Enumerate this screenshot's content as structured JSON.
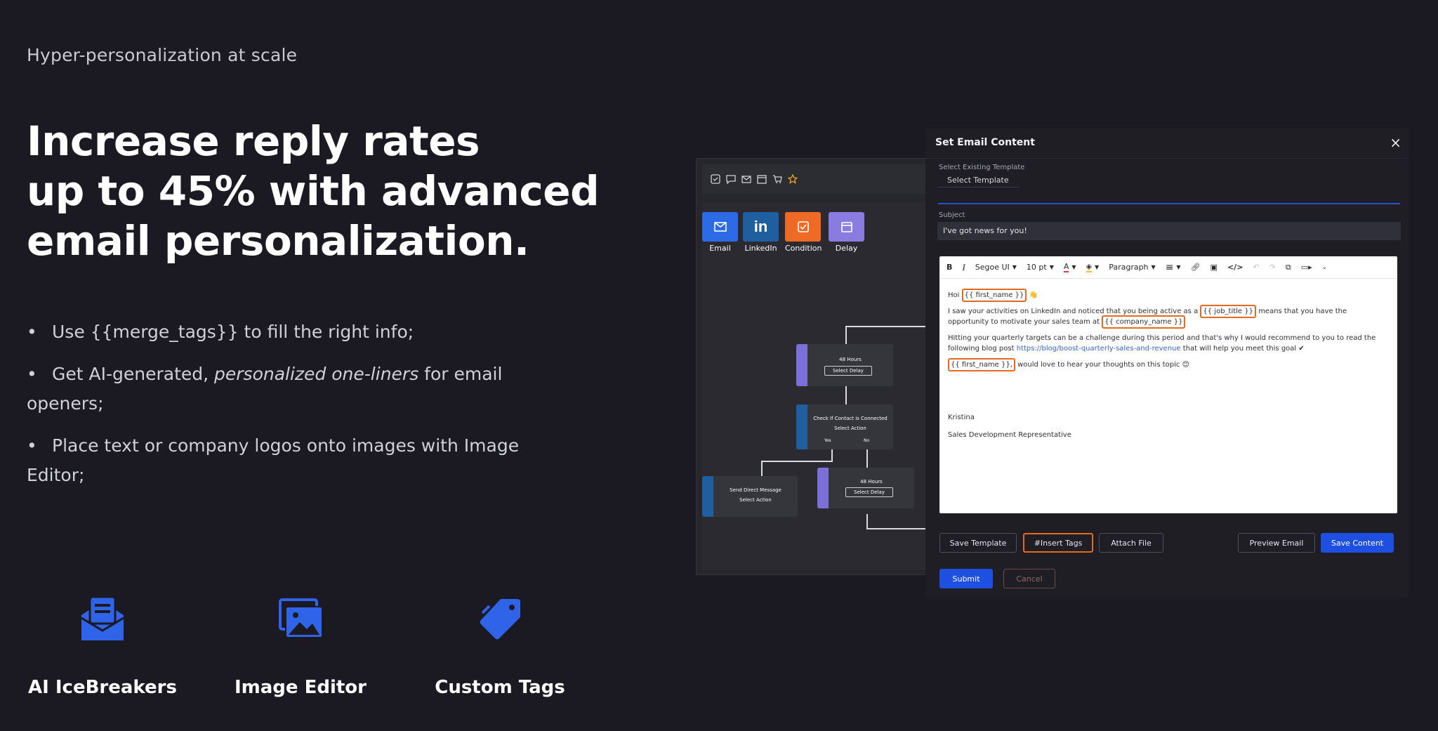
{
  "hero": {
    "eyebrow": "Hyper-personalization at scale",
    "headline_lines": [
      "Increase reply rates",
      "up to 45% with advanced",
      "email personalization."
    ]
  },
  "bullets": [
    {
      "text": "Use {{merge_tags}} to fill the right info;"
    },
    {
      "before": "Get AI-generated, ",
      "em": "personalized one-liners",
      "after": " for email openers;"
    },
    {
      "text": "Place text or company logos onto images with Image Editor;"
    }
  ],
  "features": [
    {
      "label": "AI IceBreakers",
      "icon": "envelope-open-icon"
    },
    {
      "label": "Image Editor",
      "icon": "images-icon"
    },
    {
      "label": "Custom Tags",
      "icon": "tags-icon"
    }
  ],
  "colors": {
    "background": "#1b1a22",
    "feature_icon": "#2f63e8",
    "primary_button": "#1d4fe0",
    "tag_border": "#e46a22",
    "email_node": "#2d6be6",
    "linkedin_node": "#1f5fa0",
    "condition_node": "#ee6a25",
    "delay_node": "#8a7be0"
  },
  "workflow": {
    "toolbar_icons": [
      "task-icon",
      "chat-icon",
      "mail-icon",
      "calendar-icon",
      "cart-icon",
      "star-icon"
    ],
    "node_buttons": [
      {
        "label": "Email",
        "icon": "mail-icon"
      },
      {
        "label": "LinkedIn",
        "icon": "linkedin-icon"
      },
      {
        "label": "Condition",
        "icon": "check-square-icon"
      },
      {
        "label": "Delay",
        "icon": "calendar-icon"
      }
    ],
    "cards": {
      "delay_top": {
        "title": "48 Hours",
        "button": "Select Delay"
      },
      "condition": {
        "title": "Check If Contact is Connected",
        "button": "Select Action",
        "yes": "Yes",
        "no": "No"
      },
      "message": {
        "title": "Send Direct Message",
        "button": "Select Action"
      },
      "delay_bottom": {
        "title": "48 Hours",
        "button": "Select Delay"
      }
    }
  },
  "modal": {
    "title": "Set Email Content",
    "template_label": "Select Existing Template",
    "template_value": "Select Template",
    "subject_label": "Subject",
    "subject_value": "I've got news for you!",
    "toolbar": {
      "font": "Segoe UI",
      "size": "10 pt",
      "block": "Paragraph"
    },
    "body": {
      "greeting": "Hoi",
      "tag_first_name": "{{ first_name }}",
      "p1_a": "I saw your activities on LinkedIn and noticed that you being active as a",
      "tag_job_title": "{{ job_title }}",
      "p1_b": "means that you have the opportunity to motivate your sales team at",
      "tag_company_name": "{{ company_name }}",
      "p2_a": "Hitting your quarterly targets can be a challenge during this period and that's why I would recommend to you to read the following blog post",
      "link": "https://blog/boost-quarterly-sales-and-revenue",
      "p2_b": "that will help you meet this goal",
      "tag_first_name_2": "{{ first_name }},",
      "p3": "would love to hear your thoughts on this topic",
      "signature_name": "Kristina",
      "signature_title": "Sales Development Representative"
    },
    "buttons": {
      "save_template": "Save Template",
      "insert_tags": "#Insert Tags",
      "attach_file": "Attach File",
      "preview_email": "Preview Email",
      "save_content": "Save Content",
      "submit": "Submit",
      "cancel": "Cancel"
    }
  }
}
